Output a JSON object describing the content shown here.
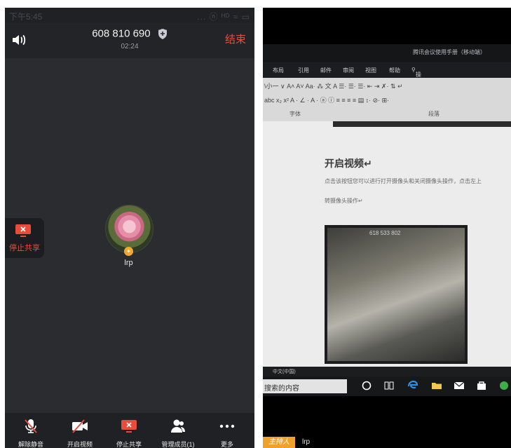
{
  "status_bar": {
    "time": "下午5:45",
    "icons": "... ⓝ ᴴᴰ ≈ ▭"
  },
  "header": {
    "meeting_id": "608 810 690",
    "timer": "02:24",
    "end_label": "结束"
  },
  "float_share": {
    "label": "停止共享"
  },
  "participant": {
    "name": "lrp",
    "badge": "✦"
  },
  "toolbar": {
    "items": [
      {
        "label": "解除静音",
        "icon": "mic-muted-icon"
      },
      {
        "label": "开启视频",
        "icon": "video-off-icon"
      },
      {
        "label": "停止共享",
        "icon": "screen-share-icon"
      },
      {
        "label": "管理成员(1)",
        "icon": "members-icon"
      },
      {
        "label": "更多",
        "icon": "more-icon"
      }
    ]
  },
  "shared_screen": {
    "doc_title": "腾讯会议使用手册（移动端）",
    "ribbon_tabs": [
      "布局",
      "引用",
      "邮件",
      "审阅",
      "视图",
      "帮助",
      "操作说明搜索"
    ],
    "ribbon_row1": "\\小一 ∨ A˄ A˅ Aa· ⁂ 文 A   ☰· ☰· ☰·  ⇤ ⇥  ✗· ⇅  ↵",
    "ribbon_row2": "abc x₂ x²  A · ∠ · A · ⓐ ⓘ    ≡ ≡ ≡ ≡ ▤  ↕· ⊘· ⊞·",
    "group_font": "字体",
    "group_paragraph": "段落",
    "heading": "开启视频↵",
    "line1": "点击该按钮您可以进行打开摄像头和关闭摄像头操作，点击左上",
    "line2": "转摄像头操作↵",
    "embedded_number": "618 533 802",
    "lang": "中文(中国)",
    "search_text": "搜索的内容",
    "presenter_badge": "主持人",
    "presenter_name": "lrp"
  },
  "colors": {
    "end": "#e74c3c",
    "accent_orange": "#f0a12b",
    "toolbar_bg": "#1f2124",
    "meeting_bg": "#2a2c30"
  }
}
